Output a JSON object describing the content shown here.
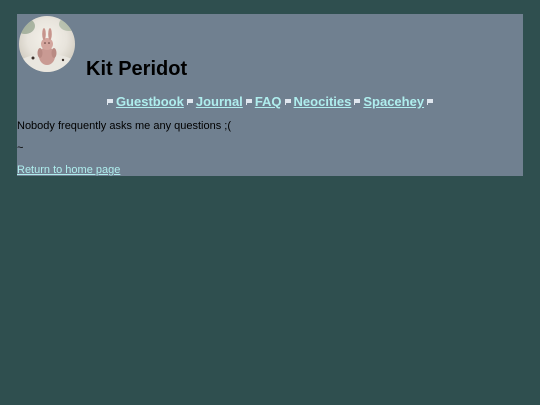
{
  "header": {
    "title": "Kit Peridot",
    "avatar_icon": "bunny-figurine-avatar"
  },
  "nav": {
    "items": [
      {
        "label": "Guestbook"
      },
      {
        "label": "Journal"
      },
      {
        "label": "FAQ"
      },
      {
        "label": "Neocities"
      },
      {
        "label": "Spacehey"
      }
    ],
    "bullet_icon": "small-flag-bullet-icon"
  },
  "content": {
    "line1": "Nobody frequently asks me any questions ;(",
    "line2": "~",
    "home_link": "Return to home page"
  },
  "colors": {
    "page_background": "#2f4f4f",
    "panel_background": "#708090",
    "link": "#afeeee",
    "text": "#000000"
  }
}
